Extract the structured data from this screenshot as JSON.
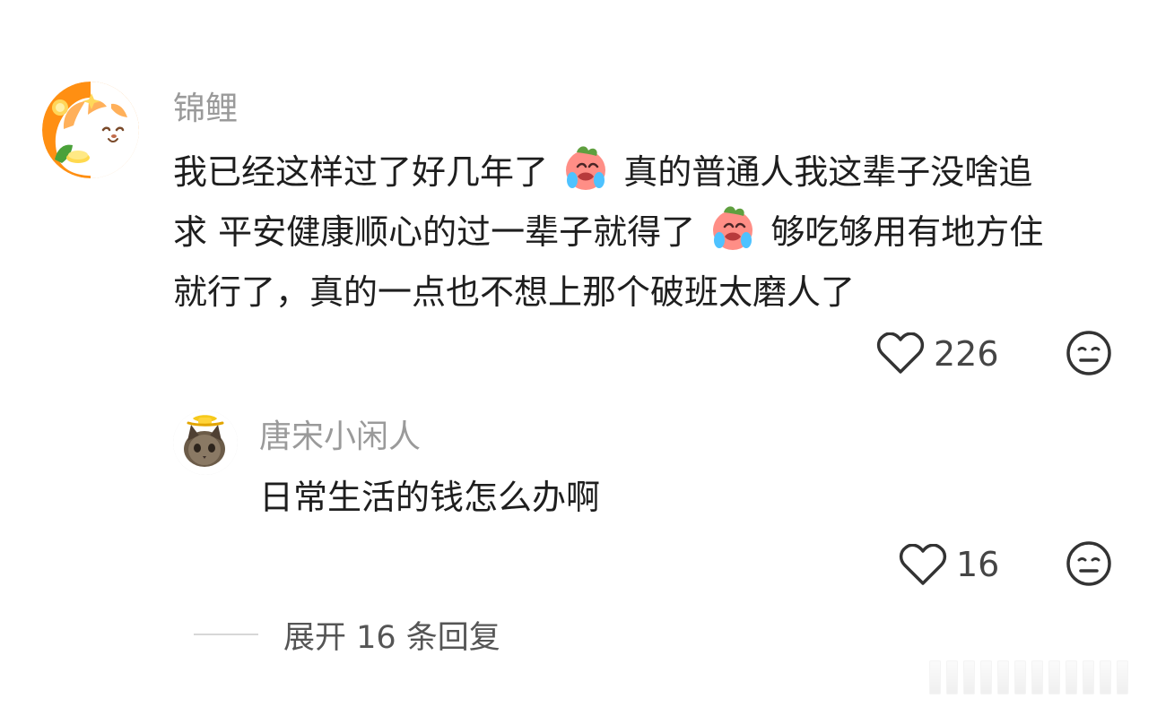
{
  "comment": {
    "author": "锦鲤",
    "text_lines": [
      [
        "我已经这样过了好几年了",
        "crying-face-emoji",
        "真的普通人我这辈子没啥追"
      ],
      [
        "求 平安健康顺心的过一辈子就得了",
        "crying-face-emoji",
        "够吃够用有地方住"
      ],
      [
        "就行了，真的一点也不想上那个破班太磨人了"
      ]
    ],
    "like_count": "226"
  },
  "reply": {
    "author": "唐宋小闲人",
    "text": "日常生活的钱怎么办啊",
    "like_count": "16"
  },
  "expand_replies": {
    "label": "展开 16 条回复"
  },
  "icons": {
    "like": "heart-outline-icon",
    "dislike": "neutral-face-icon",
    "emoji": "crying-face-emoji"
  },
  "colors": {
    "username": "#9a9a9a",
    "text": "#1e1e1e",
    "count": "#454545",
    "icon": "#333333",
    "divider": "#d7d7d7"
  }
}
